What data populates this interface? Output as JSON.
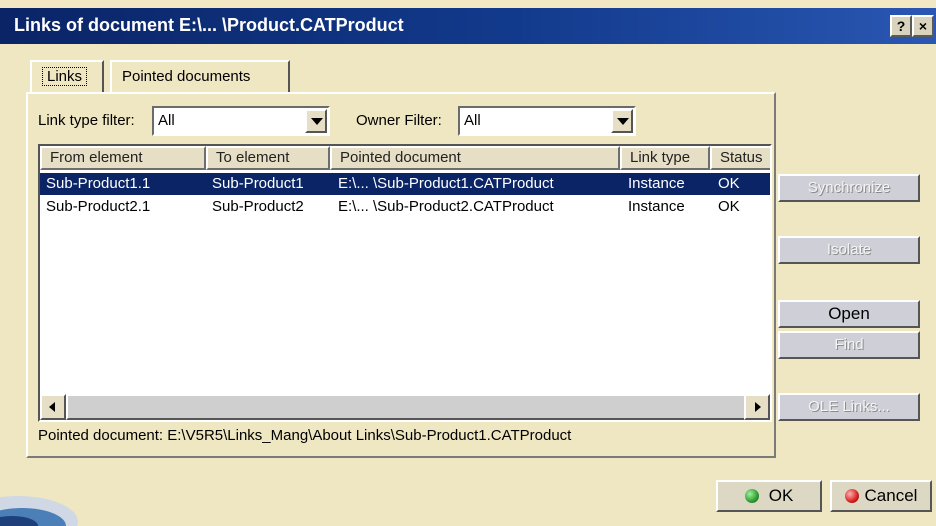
{
  "window": {
    "title": "Links of document E:\\... \\Product.CATProduct",
    "help_label": "?",
    "close_label": "×"
  },
  "tabs": [
    {
      "label": "Links",
      "active": true
    },
    {
      "label": "Pointed documents",
      "active": false
    }
  ],
  "filters": {
    "link_type_label": "Link type filter:",
    "link_type_value": "All",
    "owner_label": "Owner Filter:",
    "owner_value": "All"
  },
  "table": {
    "columns": [
      "From element",
      "To element",
      "Pointed document",
      "Link type",
      "Status"
    ],
    "rows": [
      {
        "from": "Sub-Product1.1",
        "to": "Sub-Product1",
        "doc": "E:\\... \\Sub-Product1.CATProduct",
        "type": "Instance",
        "status": "OK",
        "selected": true
      },
      {
        "from": "Sub-Product2.1",
        "to": "Sub-Product2",
        "doc": "E:\\... \\Sub-Product2.CATProduct",
        "type": "Instance",
        "status": "OK",
        "selected": false
      }
    ]
  },
  "status_line": "Pointed document: E:\\V5R5\\Links_Mang\\About Links\\Sub-Product1.CATProduct",
  "side_buttons": {
    "synchronize": "Synchronize",
    "isolate": "Isolate",
    "open": "Open",
    "find": "Find",
    "ole_links": "OLE Links..."
  },
  "footer": {
    "ok": "OK",
    "cancel": "Cancel",
    "ok_color": "#2e9c2e",
    "cancel_color": "#d42020"
  }
}
